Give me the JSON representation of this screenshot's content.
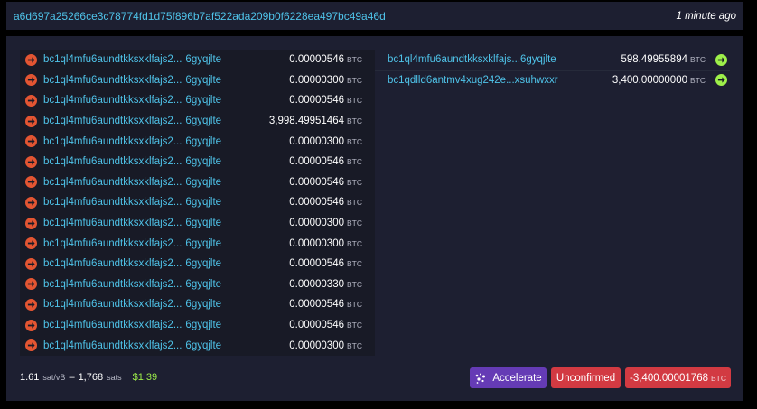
{
  "header": {
    "txid": "a6d697a25266ce3c78774fd1d75f896b7af522ada209b0f6228ea497bc49a46d",
    "time": "1 minute ago"
  },
  "inputs": [
    {
      "addr_start": "bc1ql4mfu6aundtkksxklfajs2...",
      "addr_end": "6gyqjlte",
      "amount": "0.00000546",
      "unit": "BTC"
    },
    {
      "addr_start": "bc1ql4mfu6aundtkksxklfajs2...",
      "addr_end": "6gyqjlte",
      "amount": "0.00000300",
      "unit": "BTC"
    },
    {
      "addr_start": "bc1ql4mfu6aundtkksxklfajs2...",
      "addr_end": "6gyqjlte",
      "amount": "0.00000546",
      "unit": "BTC"
    },
    {
      "addr_start": "bc1ql4mfu6aundtkksxklfajs2...",
      "addr_end": "6gyqjlte",
      "amount": "3,998.49951464",
      "unit": "BTC"
    },
    {
      "addr_start": "bc1ql4mfu6aundtkksxklfajs2...",
      "addr_end": "6gyqjlte",
      "amount": "0.00000300",
      "unit": "BTC"
    },
    {
      "addr_start": "bc1ql4mfu6aundtkksxklfajs2...",
      "addr_end": "6gyqjlte",
      "amount": "0.00000546",
      "unit": "BTC"
    },
    {
      "addr_start": "bc1ql4mfu6aundtkksxklfajs2...",
      "addr_end": "6gyqjlte",
      "amount": "0.00000546",
      "unit": "BTC"
    },
    {
      "addr_start": "bc1ql4mfu6aundtkksxklfajs2...",
      "addr_end": "6gyqjlte",
      "amount": "0.00000546",
      "unit": "BTC"
    },
    {
      "addr_start": "bc1ql4mfu6aundtkksxklfajs2...",
      "addr_end": "6gyqjlte",
      "amount": "0.00000300",
      "unit": "BTC"
    },
    {
      "addr_start": "bc1ql4mfu6aundtkksxklfajs2...",
      "addr_end": "6gyqjlte",
      "amount": "0.00000300",
      "unit": "BTC"
    },
    {
      "addr_start": "bc1ql4mfu6aundtkksxklfajs2...",
      "addr_end": "6gyqjlte",
      "amount": "0.00000546",
      "unit": "BTC"
    },
    {
      "addr_start": "bc1ql4mfu6aundtkksxklfajs2...",
      "addr_end": "6gyqjlte",
      "amount": "0.00000330",
      "unit": "BTC"
    },
    {
      "addr_start": "bc1ql4mfu6aundtkksxklfajs2...",
      "addr_end": "6gyqjlte",
      "amount": "0.00000546",
      "unit": "BTC"
    },
    {
      "addr_start": "bc1ql4mfu6aundtkksxklfajs2...",
      "addr_end": "6gyqjlte",
      "amount": "0.00000546",
      "unit": "BTC"
    },
    {
      "addr_start": "bc1ql4mfu6aundtkksxklfajs2...",
      "addr_end": "6gyqjlte",
      "amount": "0.00000300",
      "unit": "BTC"
    }
  ],
  "outputs": [
    {
      "address": "bc1ql4mfu6aundtkksxklfajs...6gyqjlte",
      "amount": "598.49955894",
      "unit": "BTC"
    },
    {
      "address": "bc1qdlld6antmv4xug242e...xsuhwxxr",
      "amount": "3,400.00000000",
      "unit": "BTC"
    }
  ],
  "footer": {
    "fee_rate": "1.61",
    "fee_rate_unit": "sat/vB",
    "dash": "–",
    "fee_sats": "1,768",
    "fee_sats_unit": "sats",
    "fee_usd": "$1.39",
    "accelerate_label": "Accelerate",
    "status_label": "Unconfirmed",
    "total_amount": "-3,400.00001768",
    "total_unit": "BTC"
  },
  "colors": {
    "background": "#000000",
    "panel": "#1d1f31",
    "input_area": "#181a26",
    "link": "#4fc3e9",
    "input_arrow": "#e35532",
    "output_arrow": "#9ef04a",
    "accelerate": "#653bb5",
    "danger": "#d23a42",
    "usd": "#9ef04a"
  },
  "icons": {
    "input_arrow": "arrow-right-circle-icon",
    "output_arrow": "arrow-right-circle-icon",
    "accelerate": "rocket-sparkle-icon"
  }
}
